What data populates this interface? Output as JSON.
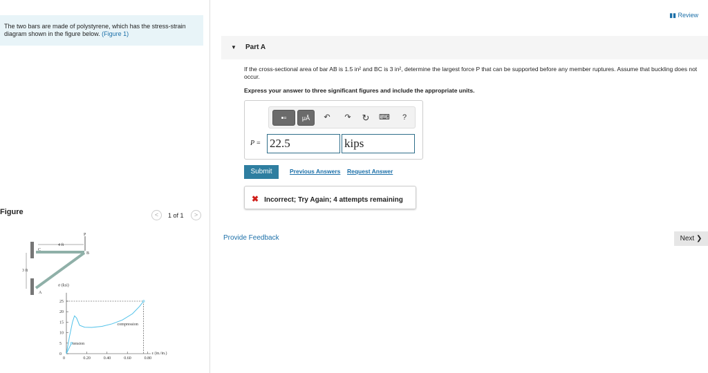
{
  "intro": {
    "text": "The two bars are made of polystyrene, which has the stress-strain diagram shown in the figure below. ",
    "link": "(Figure 1)"
  },
  "figure": {
    "title": "Figure",
    "pager": "1 of 1",
    "prev": "<",
    "next": ">",
    "labels": {
      "P": "P",
      "dim_h": "4 ft",
      "dim_v": "3 ft",
      "C": "C",
      "B": "B",
      "A": "A",
      "ylabel": "σ (ksi)",
      "xlabel": "ε (in./in.)",
      "compression": "compression",
      "tension": "tension"
    },
    "chart_data": {
      "type": "line",
      "xlabel": "ε (in./in.)",
      "ylabel": "σ (ksi)",
      "xlim": [
        0,
        0.8
      ],
      "ylim": [
        0,
        25
      ],
      "xticks": [
        "0",
        "0.20",
        "0.40",
        "0.60",
        "0.80"
      ],
      "yticks": [
        "0",
        "5",
        "10",
        "15",
        "20",
        "25"
      ],
      "series": [
        {
          "name": "compression",
          "x": [
            0,
            0.03,
            0.06,
            0.08,
            0.1,
            0.13,
            0.18,
            0.25,
            0.35,
            0.45,
            0.55,
            0.65,
            0.72,
            0.76
          ],
          "y": [
            0,
            8,
            15,
            18,
            17,
            13.5,
            12.6,
            12.5,
            13,
            14.2,
            16,
            19,
            22.5,
            25
          ]
        },
        {
          "name": "tension",
          "x": [
            0,
            0.05
          ],
          "y": [
            0,
            5
          ]
        }
      ]
    }
  },
  "review": "Review",
  "part": {
    "label": "Part A",
    "question": "If the cross-sectional area of bar AB is 1.5 in² and BC is 3 in², determine the largest force P that can be supported before any member ruptures. Assume that buckling does not occur.",
    "instruction": "Express your answer to three significant figures and include the appropriate units.",
    "toolbar": {
      "units": "μÅ",
      "undo": "↶",
      "redo": "↷",
      "reset": "↻",
      "keyboard": "⌨",
      "help": "?"
    },
    "var": "P =",
    "value": "22.5",
    "units": "kips",
    "submit": "Submit",
    "previous": "Previous Answers",
    "request": "Request Answer",
    "feedback_icon": "✖",
    "feedback": "Incorrect; Try Again; 4 attempts remaining"
  },
  "provide_feedback": "Provide Feedback",
  "next": "Next ❯",
  "colors": {
    "accent": "#2e7ea0",
    "link": "#1b6fa8",
    "error": "#d0201b",
    "curve": "#4fc1e9"
  }
}
